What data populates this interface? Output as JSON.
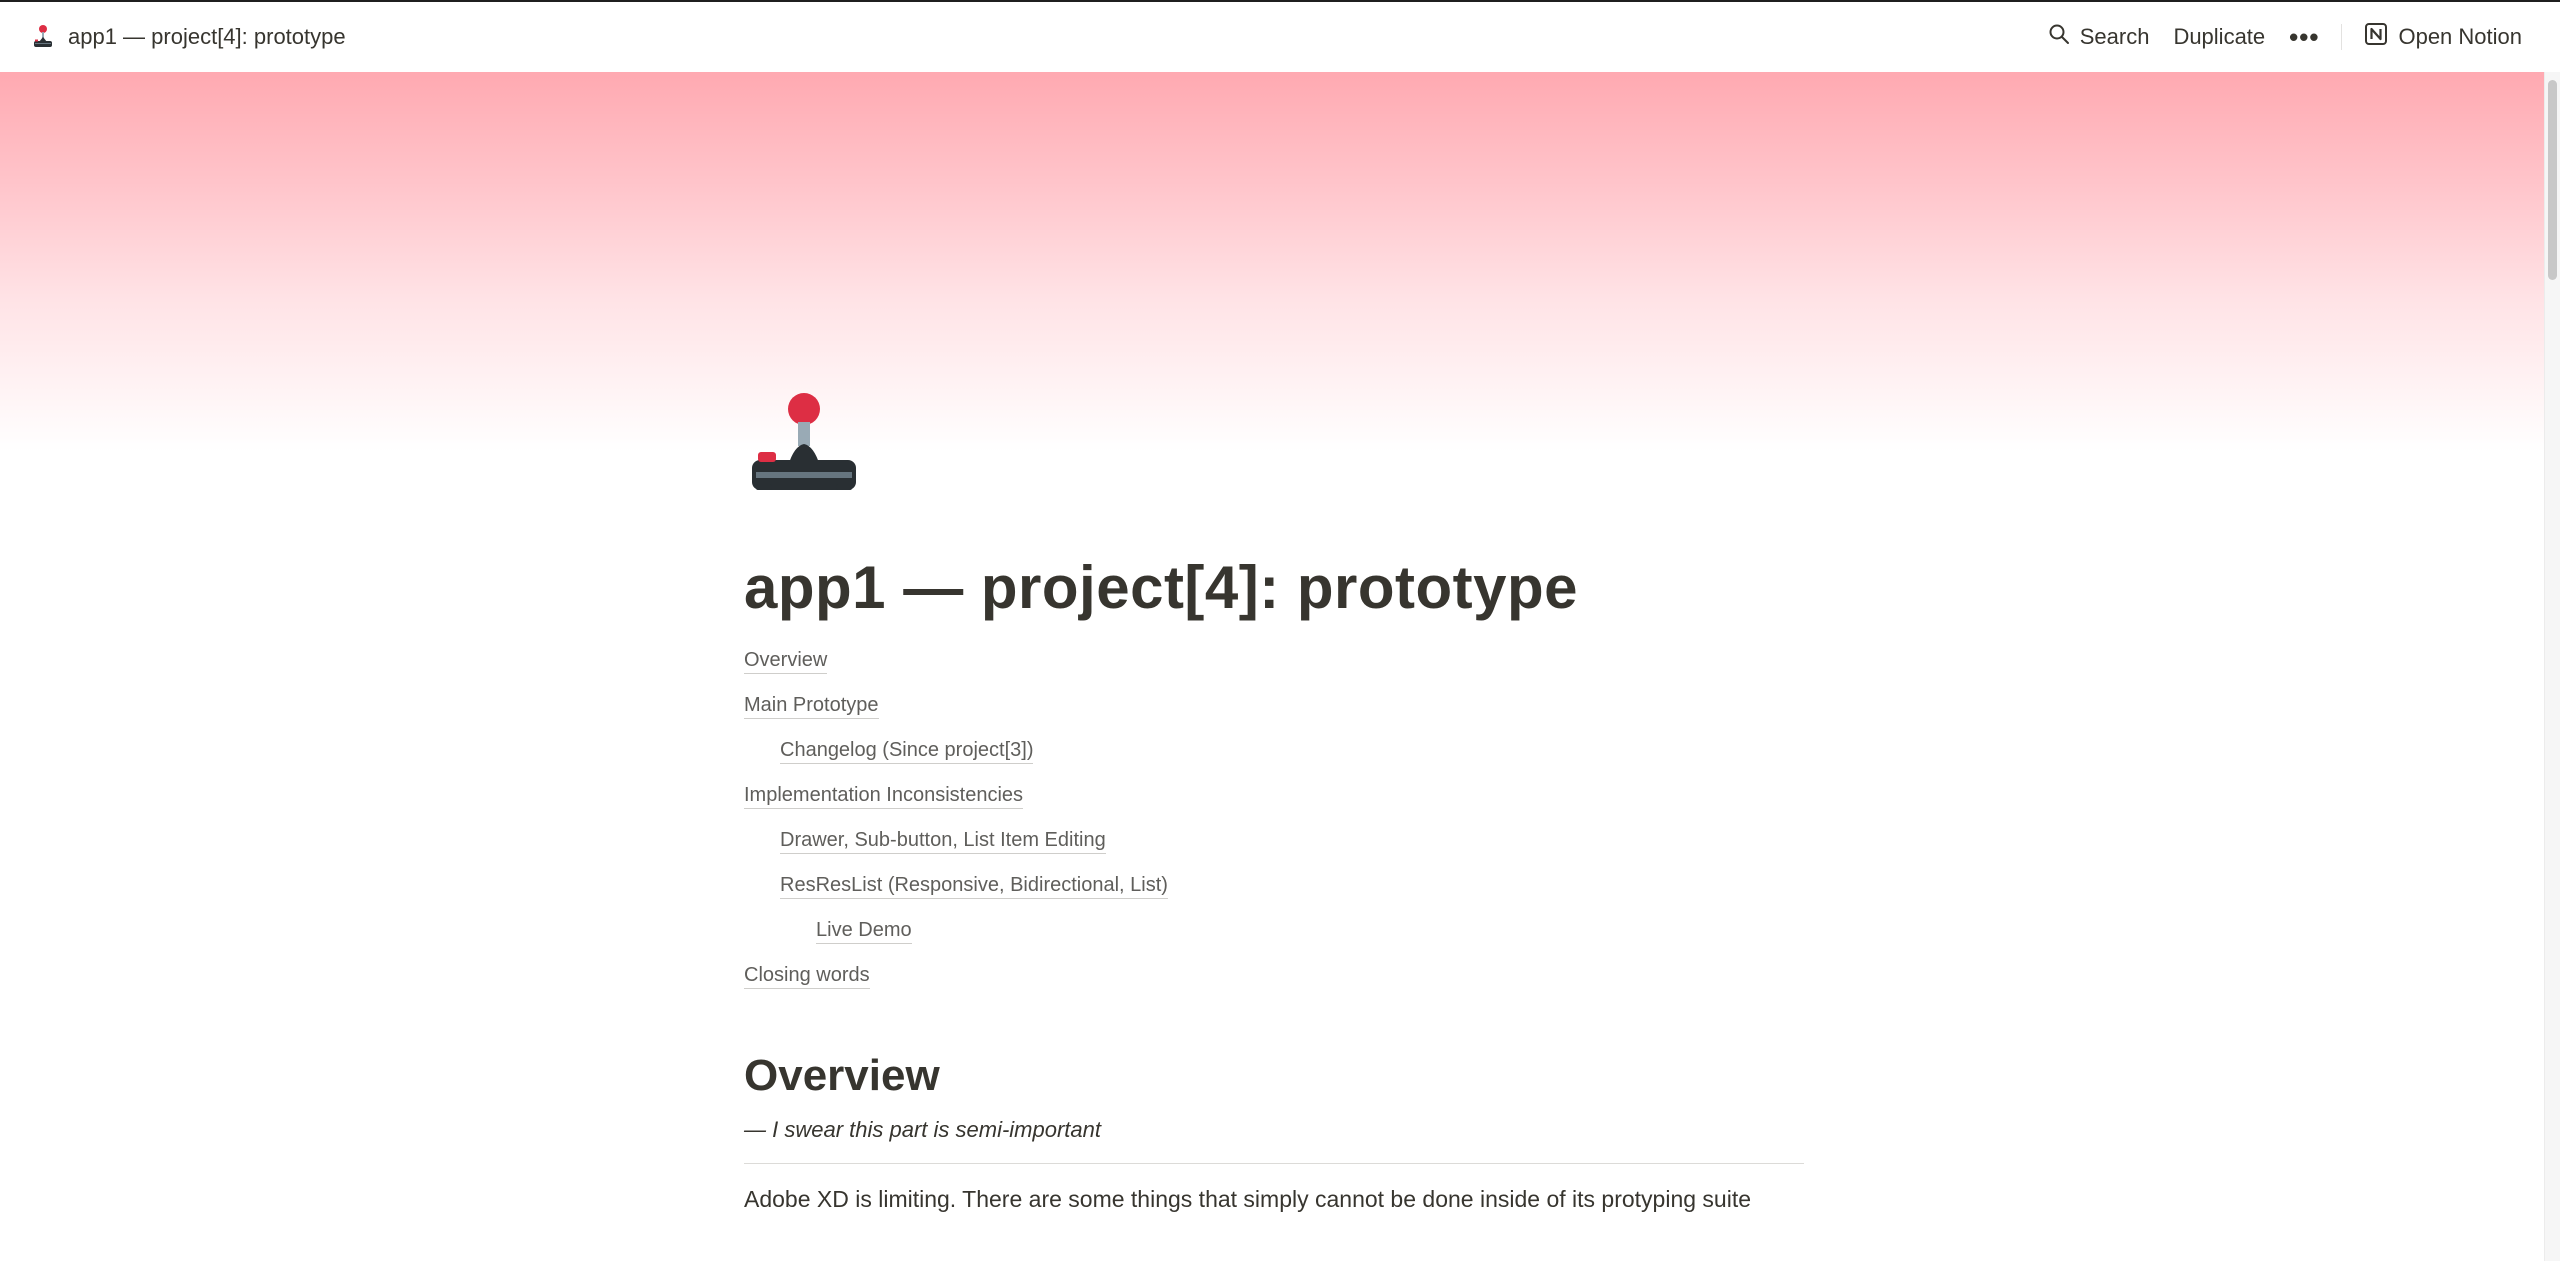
{
  "topbar": {
    "breadcrumb_title": "app1 — project[4]: prototype",
    "page_icon": "joystick-icon",
    "search_label": "Search",
    "duplicate_label": "Duplicate",
    "more_icon": "more-horizontal-icon",
    "open_notion_label": "Open Notion"
  },
  "cover": {
    "gradient_colors": [
      "#ffa9b1",
      "#ffffff"
    ]
  },
  "page": {
    "icon": "joystick-icon",
    "title": "app1 — project[4]: prototype"
  },
  "toc": {
    "items": [
      {
        "label": "Overview",
        "level": 0
      },
      {
        "label": "Main Prototype",
        "level": 0
      },
      {
        "label": "Changelog (Since project[3])",
        "level": 1
      },
      {
        "label": "Implementation Inconsistencies",
        "level": 0
      },
      {
        "label": "Drawer, Sub-button, List Item Editing",
        "level": 1
      },
      {
        "label": "ResResList (Responsive, Bidirectional, List)",
        "level": 1
      },
      {
        "label": "Live Demo",
        "level": 2
      },
      {
        "label": "Closing words",
        "level": 0
      }
    ]
  },
  "overview": {
    "heading": "Overview",
    "subtitle": "— I swear this part is semi-important",
    "paragraph": "Adobe XD is limiting. There are some things that simply cannot be done inside of its protyping suite"
  }
}
